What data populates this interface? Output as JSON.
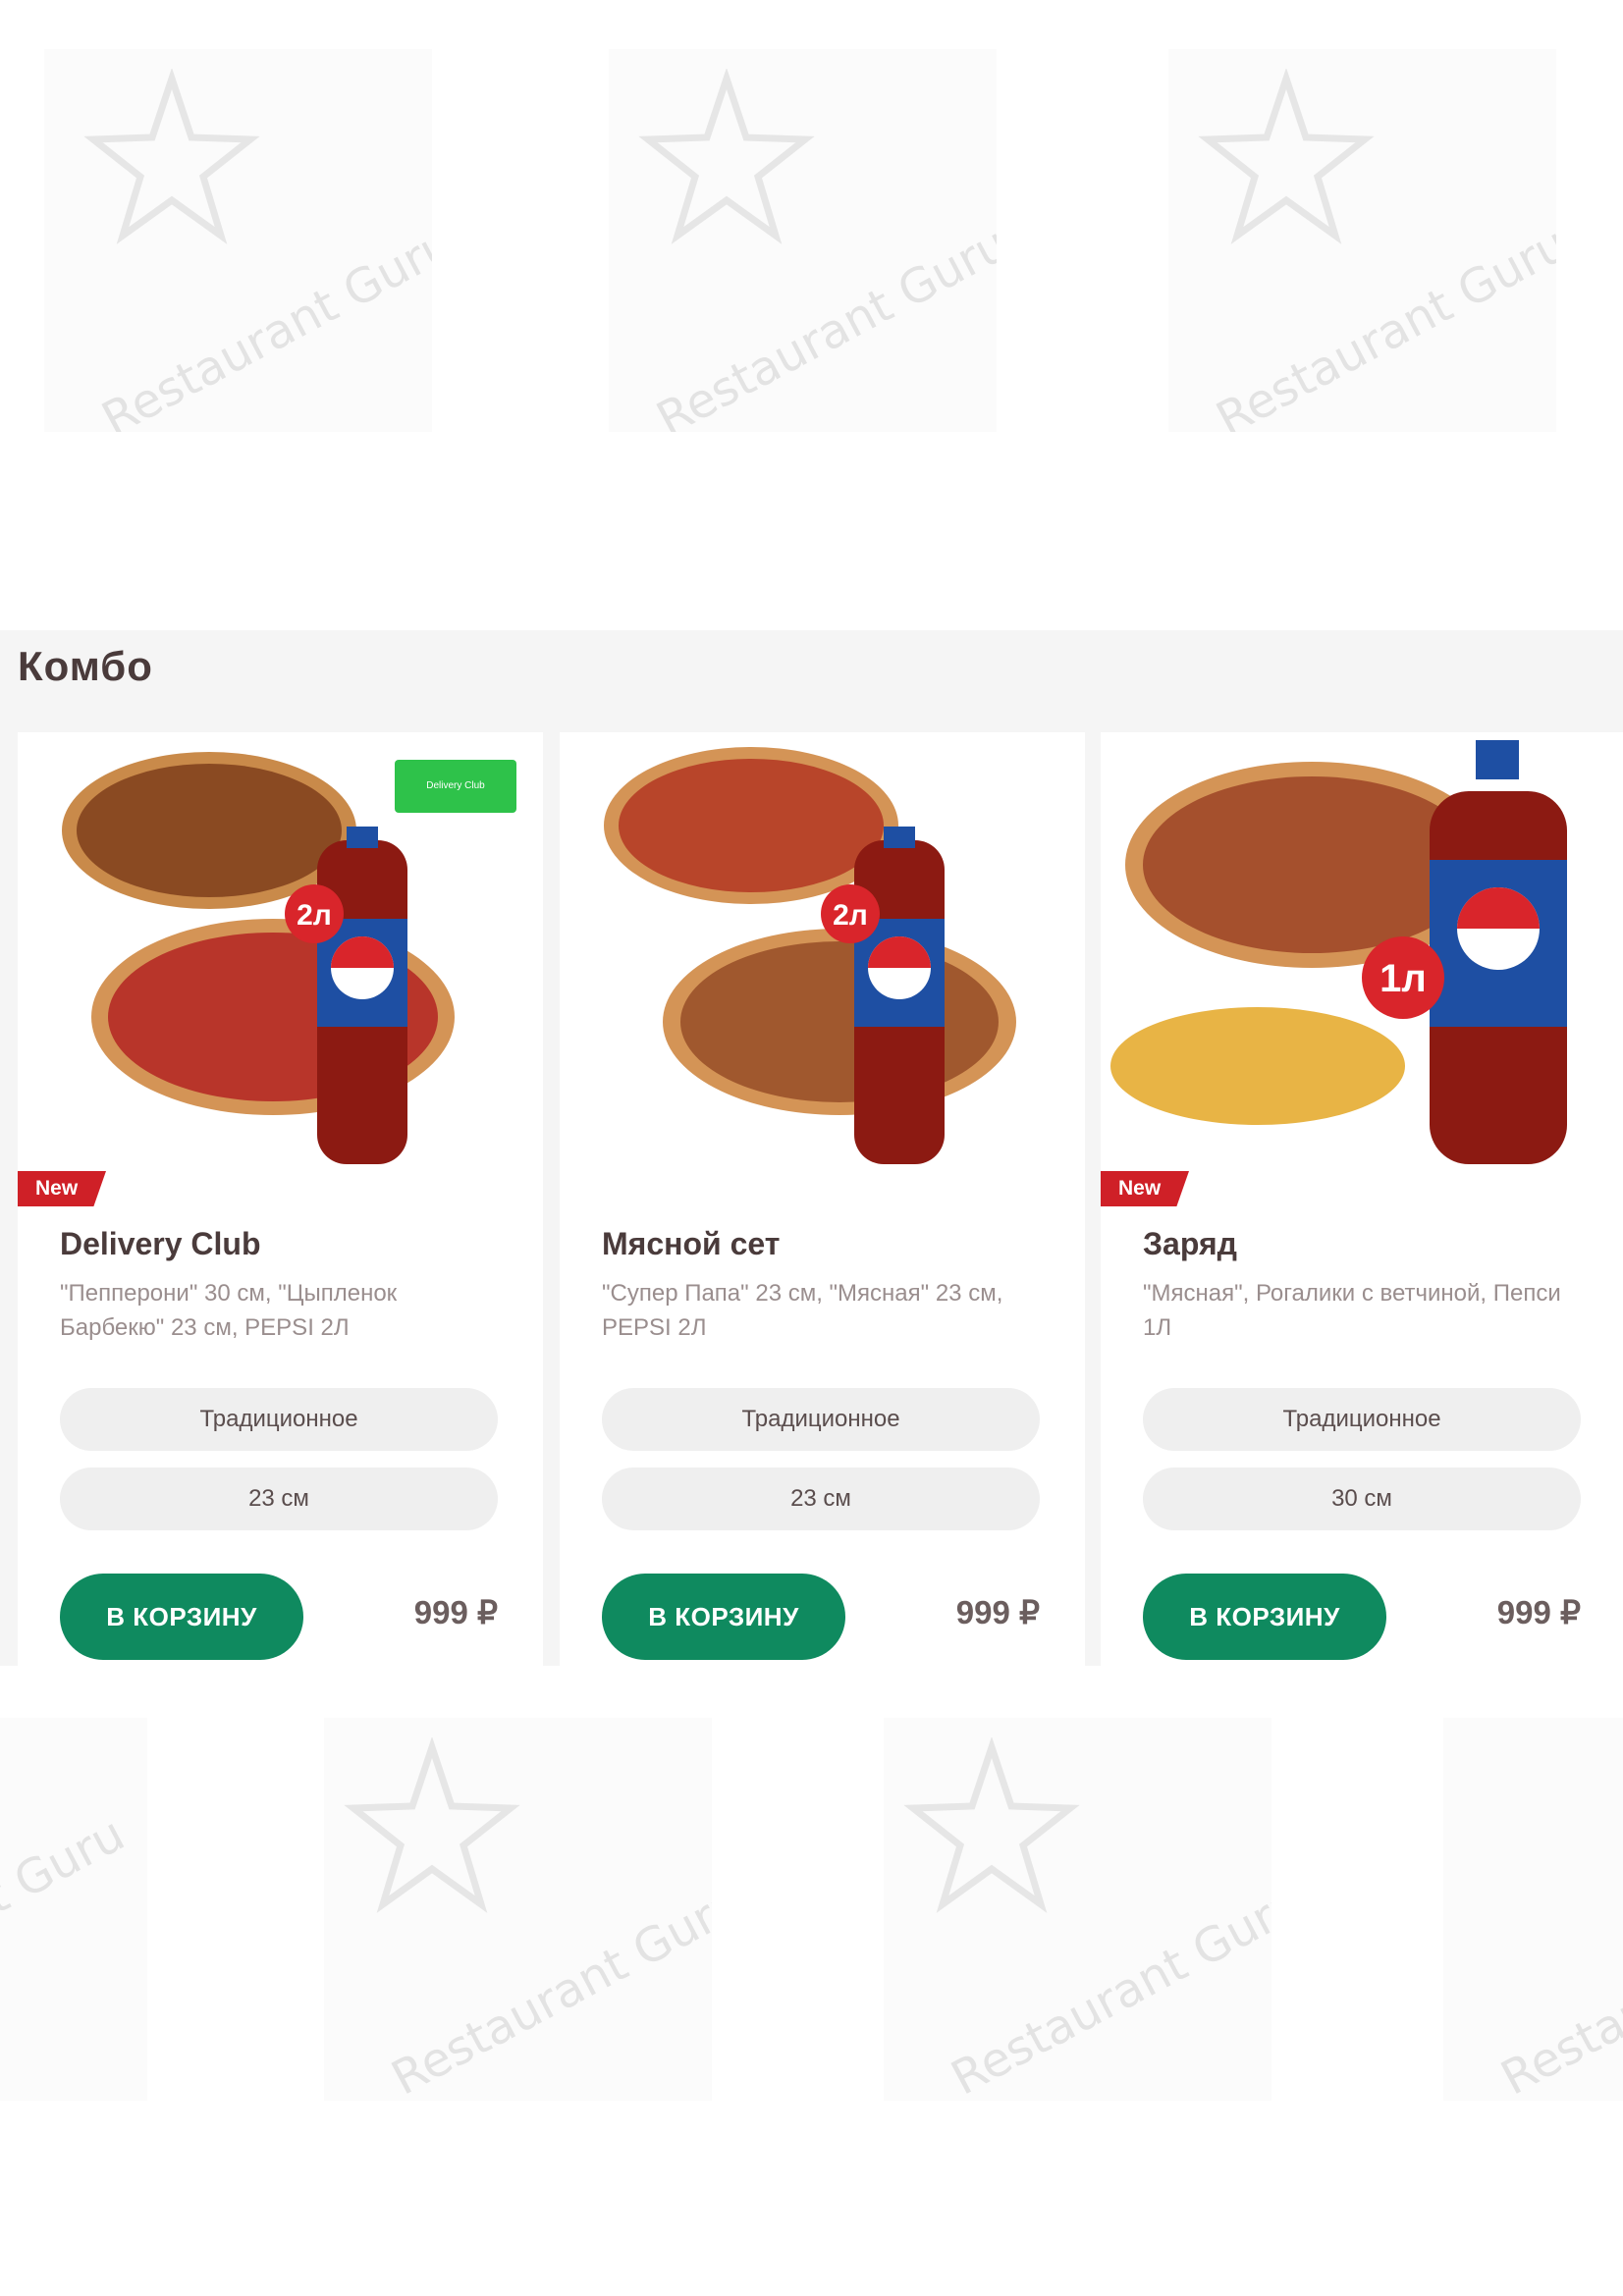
{
  "section": {
    "title": "Комбо"
  },
  "watermark": {
    "text": "Restaurant Guru"
  },
  "cards": [
    {
      "badge": "New",
      "name": "Delivery Club",
      "description": "\"Пепперони\" 30 см, \"Цыпленок Барбекю\" 23 см, PEPSI 2Л",
      "dough": "Традиционное",
      "size": "23 см",
      "button": "В КОРЗИНУ",
      "price": "999 ₽",
      "bottle_label": "2л",
      "partner_logo": "Delivery Club"
    },
    {
      "badge": "",
      "name": "Мясной сет",
      "description": "\"Супер Папа\" 23 см, \"Мясная\" 23 см, PEPSI 2Л",
      "dough": "Традиционное",
      "size": "23 см",
      "button": "В КОРЗИНУ",
      "price": "999 ₽",
      "bottle_label": "2л"
    },
    {
      "badge": "New",
      "name": "Заряд",
      "description": "\"Мясная\", Рогалики с ветчиной, Пепси 1Л",
      "dough": "Традиционное",
      "size": "30 см",
      "button": "В КОРЗИНУ",
      "price": "999 ₽",
      "bottle_label": "1л"
    }
  ],
  "colors": {
    "accent_green": "#0f8a5f",
    "badge_red": "#cf2027",
    "pepsi_blue": "#1e4fa3"
  }
}
